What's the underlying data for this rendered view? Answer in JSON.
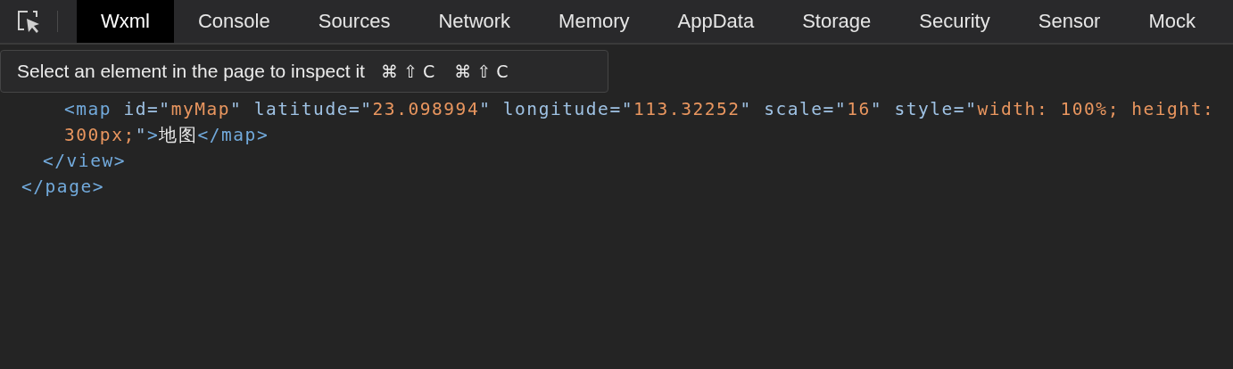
{
  "toolbar": {
    "inspect_selected": false,
    "tabs": [
      {
        "label": "Wxml",
        "selected": true
      },
      {
        "label": "Console",
        "selected": false
      },
      {
        "label": "Sources",
        "selected": false
      },
      {
        "label": "Network",
        "selected": false
      },
      {
        "label": "Memory",
        "selected": false
      },
      {
        "label": "AppData",
        "selected": false
      },
      {
        "label": "Storage",
        "selected": false
      },
      {
        "label": "Security",
        "selected": false
      },
      {
        "label": "Sensor",
        "selected": false
      },
      {
        "label": "Mock",
        "selected": false
      }
    ]
  },
  "tooltip": {
    "text": "Select an element in the page to inspect it",
    "shortcuts": [
      "⌘ ⇧ C",
      "⌘ ⇧ C"
    ]
  },
  "tree": [
    {
      "close": [
        {
          "kind": "tag",
          "text": "</page>"
        }
      ],
      "children": [
        {
          "close": [
            {
              "kind": "tag",
              "text": "</view>"
            }
          ],
          "children": [
            {
              "open": [
                {
                  "kind": "tag",
                  "text": "<map"
                },
                {
                  "kind": "attr",
                  "text": " id=\""
                },
                {
                  "kind": "value",
                  "text": "myMap"
                },
                {
                  "kind": "attr",
                  "text": "\" latitude=\""
                },
                {
                  "kind": "value",
                  "text": "23.098994"
                },
                {
                  "kind": "attr",
                  "text": "\" longitude=\""
                },
                {
                  "kind": "value",
                  "text": "113.32252"
                },
                {
                  "kind": "attr",
                  "text": "\" scale=\""
                },
                {
                  "kind": "value",
                  "text": "16"
                },
                {
                  "kind": "attr",
                  "text": "\" style=\""
                },
                {
                  "kind": "value",
                  "text": "width: 100%; height: 300px;"
                },
                {
                  "kind": "attr",
                  "text": "\""
                },
                {
                  "kind": "tag",
                  "text": ">"
                },
                {
                  "kind": "text",
                  "text": "地图"
                },
                {
                  "kind": "tag",
                  "text": "</map>"
                }
              ]
            }
          ]
        }
      ]
    }
  ]
}
